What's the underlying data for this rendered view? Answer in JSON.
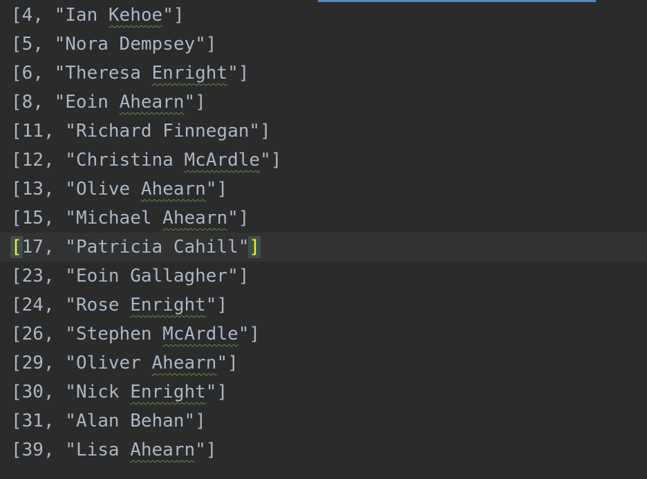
{
  "editor": {
    "accent_color": "#4a88c7",
    "lines": [
      {
        "id": "4",
        "pre": "Ian ",
        "flagged": "Kehoe",
        "current": false
      },
      {
        "id": "5",
        "pre": "Nora Dempsey",
        "flagged": "",
        "current": false
      },
      {
        "id": "6",
        "pre": "Theresa ",
        "flagged": "Enright",
        "current": false
      },
      {
        "id": "8",
        "pre": "Eoin ",
        "flagged": "Ahearn",
        "current": false
      },
      {
        "id": "11",
        "pre": "Richard Finnegan",
        "flagged": "",
        "current": false
      },
      {
        "id": "12",
        "pre": "Christina ",
        "flagged": "McArdle",
        "current": false
      },
      {
        "id": "13",
        "pre": "Olive ",
        "flagged": "Ahearn",
        "current": false
      },
      {
        "id": "15",
        "pre": "Michael ",
        "flagged": "Ahearn",
        "current": false
      },
      {
        "id": "17",
        "pre": "Patricia Cahill",
        "flagged": "",
        "current": true
      },
      {
        "id": "23",
        "pre": "Eoin Gallagher",
        "flagged": "",
        "current": false
      },
      {
        "id": "24",
        "pre": "Rose ",
        "flagged": "Enright",
        "current": false
      },
      {
        "id": "26",
        "pre": "Stephen ",
        "flagged": "McArdle",
        "current": false
      },
      {
        "id": "29",
        "pre": "Oliver ",
        "flagged": "Ahearn",
        "current": false
      },
      {
        "id": "30",
        "pre": "Nick ",
        "flagged": "Enright",
        "current": false
      },
      {
        "id": "31",
        "pre": "Alan Behan",
        "flagged": "",
        "current": false
      },
      {
        "id": "39",
        "pre": "Lisa ",
        "flagged": "Ahearn",
        "current": false
      }
    ]
  }
}
